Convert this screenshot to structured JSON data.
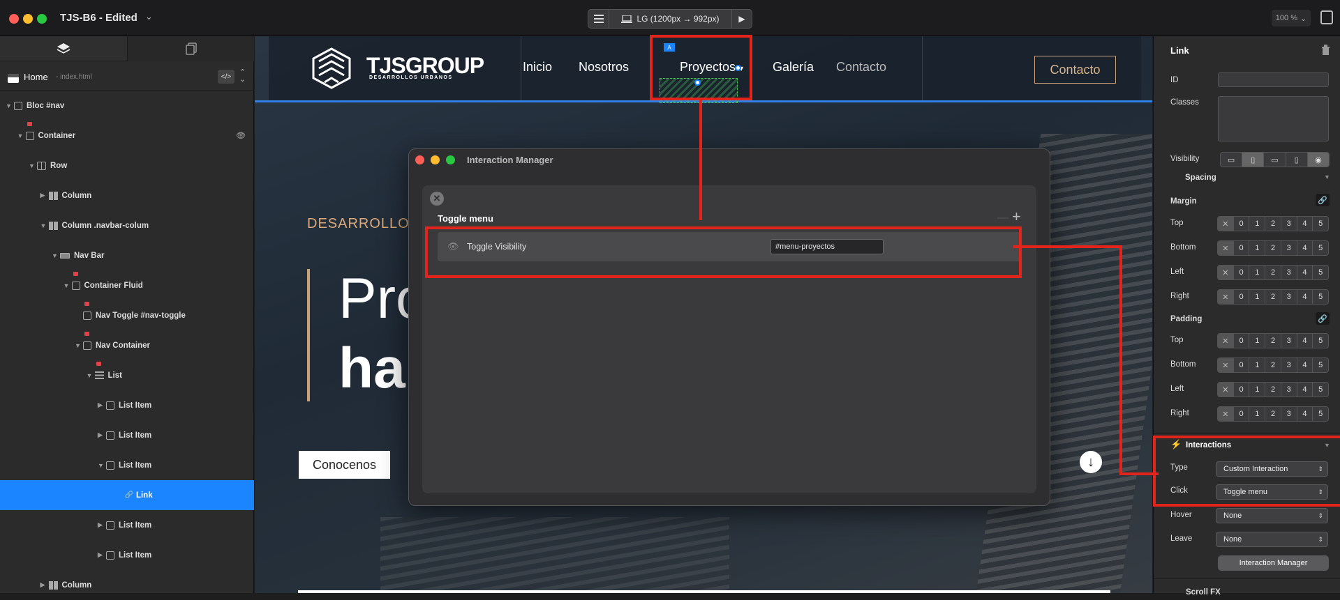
{
  "window": {
    "title": "TJS-B6 - Edited",
    "colors": {
      "close": "#ff5f57",
      "minimize": "#febc2e",
      "zoom": "#28c840"
    }
  },
  "toolbar": {
    "breakpoint_label": "LG (1200px → 992px)",
    "zoom_label": "100 %"
  },
  "left_panel": {
    "page_name": "Home",
    "page_file": "- index.html",
    "tree": [
      {
        "label": "Bloc #nav",
        "depth": 0,
        "icon": "bloc-icon",
        "open": true
      },
      {
        "label": "Container",
        "depth": 1,
        "icon": "container-icon",
        "open": true,
        "locked": true,
        "eye": true
      },
      {
        "label": "Row",
        "depth": 2,
        "icon": "row-icon",
        "open": true
      },
      {
        "label": "Column",
        "depth": 3,
        "icon": "column-icon",
        "open": false
      },
      {
        "label": "Column .navbar-colum",
        "depth": 3,
        "icon": "column-icon",
        "open": true
      },
      {
        "label": "Nav Bar",
        "depth": 4,
        "icon": "navbar-icon",
        "open": true
      },
      {
        "label": "Container Fluid",
        "depth": 5,
        "icon": "container-icon",
        "open": true,
        "locked": true
      },
      {
        "label": "Nav Toggle #nav-toggle",
        "depth": 6,
        "icon": "toggle-icon",
        "locked": true
      },
      {
        "label": "Nav Container",
        "depth": 6,
        "icon": "container-icon",
        "open": true,
        "locked": true
      },
      {
        "label": "List",
        "depth": 7,
        "icon": "list-icon",
        "open": true,
        "locked": true
      },
      {
        "label": "List Item",
        "depth": 8,
        "icon": "container-icon",
        "open": false
      },
      {
        "label": "List Item",
        "depth": 8,
        "icon": "container-icon",
        "open": false
      },
      {
        "label": "List Item",
        "depth": 8,
        "icon": "container-icon",
        "open": true
      },
      {
        "label": "Link",
        "depth": 9,
        "icon": "link-icon",
        "selected": true
      },
      {
        "label": "List Item",
        "depth": 8,
        "icon": "container-icon",
        "open": false
      },
      {
        "label": "List Item",
        "depth": 8,
        "icon": "container-icon",
        "open": false
      },
      {
        "label": "Column",
        "depth": 3,
        "icon": "column-icon",
        "open": false
      }
    ]
  },
  "site": {
    "logo_name": "TJSGROUP",
    "logo_sub": "DESARROLLOS URBANOS",
    "nav_links": [
      "Inicio",
      "Nosotros",
      "Proyectos",
      "Galería",
      "Contacto"
    ],
    "nav_cta": "Contacto",
    "selection_tag": "A",
    "hero_kicker": "DESARROLLO",
    "hero_line1": "Pro",
    "hero_line2": "ha",
    "hero_button": "Conocenos",
    "accent_color": "#c9a27a"
  },
  "interaction_manager": {
    "title": "Interaction Manager",
    "interaction_name": "Toggle menu",
    "action": "Toggle Visibility",
    "target": "#menu-proyectos"
  },
  "right_panel": {
    "element_type": "Link",
    "id_label": "ID",
    "classes_label": "Classes",
    "visibility_label": "Visibility",
    "spacing_label": "Spacing",
    "margin_label": "Margin",
    "padding_label": "Padding",
    "sides": [
      "Top",
      "Bottom",
      "Left",
      "Right"
    ],
    "spacing_values": [
      "0",
      "1",
      "2",
      "3",
      "4",
      "5"
    ],
    "interactions_label": "Interactions",
    "type_label": "Type",
    "type_value": "Custom Interaction",
    "click_label": "Click",
    "click_value": "Toggle menu",
    "hover_label": "Hover",
    "hover_value": "None",
    "leave_label": "Leave",
    "leave_value": "None",
    "manager_button": "Interaction Manager",
    "next_section": "Scroll FX"
  },
  "annotation_color": "#e3241b"
}
